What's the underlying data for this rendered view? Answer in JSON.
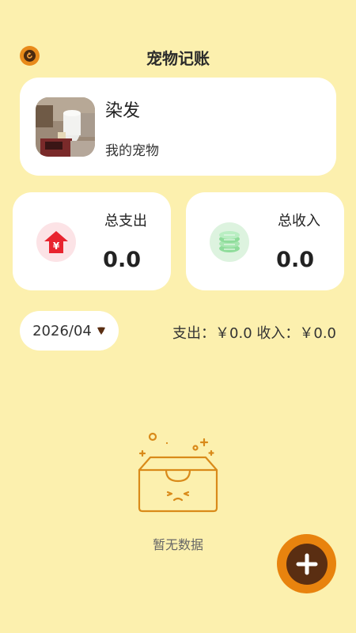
{
  "header": {
    "title": "宠物记账",
    "back_icon": "back-circle-icon"
  },
  "pet": {
    "name": "染发",
    "subtitle": "我的宠物"
  },
  "stats": {
    "expense": {
      "label": "总支出",
      "value": "0.0",
      "icon": "yen-house-icon",
      "color": "#E8242F"
    },
    "income": {
      "label": "总收入",
      "value": "0.0",
      "icon": "coins-icon",
      "color": "#7FD68C"
    }
  },
  "filter": {
    "date": "2026/04",
    "dropdown_icon": "triangle-down-icon"
  },
  "summary": {
    "text": "支出：￥0.0 收入：￥0.0"
  },
  "empty": {
    "text": "暂无数据",
    "icon": "empty-box-icon"
  },
  "fab": {
    "icon": "plus-icon"
  },
  "colors": {
    "background": "#FCF0AE",
    "accent": "#E8830E",
    "accent_dark": "#5A2E12"
  }
}
